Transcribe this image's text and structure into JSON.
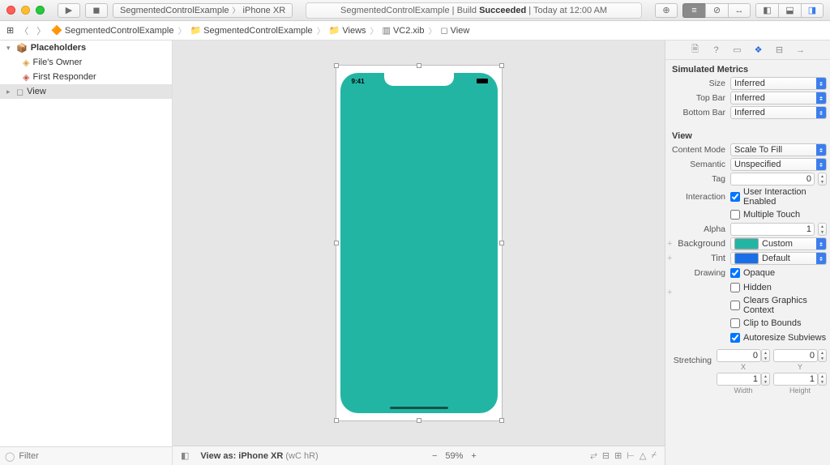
{
  "titlebar": {
    "scheme": {
      "target": "SegmentedControlExample",
      "device": "iPhone XR"
    },
    "status": {
      "product": "SegmentedControlExample",
      "action": "Build",
      "result": "Succeeded",
      "when": "Today at 12:00 AM"
    }
  },
  "jumpbar": {
    "items": [
      "SegmentedControlExample",
      "SegmentedControlExample",
      "Views",
      "VC2.xib",
      "View"
    ]
  },
  "navigator": {
    "placeholders": {
      "header": "Placeholders",
      "items": [
        "File's Owner",
        "First Responder"
      ]
    },
    "objects": [
      "View"
    ],
    "filter_placeholder": "Filter"
  },
  "canvas": {
    "time": "9:41",
    "device_color": "#23b5a4",
    "footer": {
      "view_as": "View as: iPhone XR",
      "trait_hint": "(wC hR)",
      "zoom": "59%"
    }
  },
  "inspector": {
    "simulated": {
      "header": "Simulated Metrics",
      "size": "Inferred",
      "top_bar": "Inferred",
      "bottom_bar": "Inferred"
    },
    "view": {
      "header": "View",
      "content_mode": "Scale To Fill",
      "semantic": "Unspecified",
      "tag": "0",
      "interaction": {
        "user_interaction": "User Interaction Enabled",
        "multiple_touch": "Multiple Touch"
      },
      "alpha": "1",
      "background": {
        "label": "Custom",
        "swatch": "#23b5a4"
      },
      "tint": {
        "label": "Default",
        "swatch": "#1a6fe8"
      },
      "drawing": {
        "opaque": "Opaque",
        "hidden": "Hidden",
        "clears": "Clears Graphics Context",
        "clip": "Clip to Bounds",
        "autoresize": "Autoresize Subviews"
      },
      "stretching": {
        "x": "0",
        "y": "0",
        "w": "1",
        "h": "1",
        "xl": "X",
        "yl": "Y",
        "wl": "Width",
        "hl": "Height"
      }
    },
    "labels": {
      "size": "Size",
      "top_bar": "Top Bar",
      "bottom_bar": "Bottom Bar",
      "content_mode": "Content Mode",
      "semantic": "Semantic",
      "tag": "Tag",
      "interaction": "Interaction",
      "alpha": "Alpha",
      "background": "Background",
      "tint": "Tint",
      "drawing": "Drawing",
      "stretching": "Stretching"
    }
  }
}
